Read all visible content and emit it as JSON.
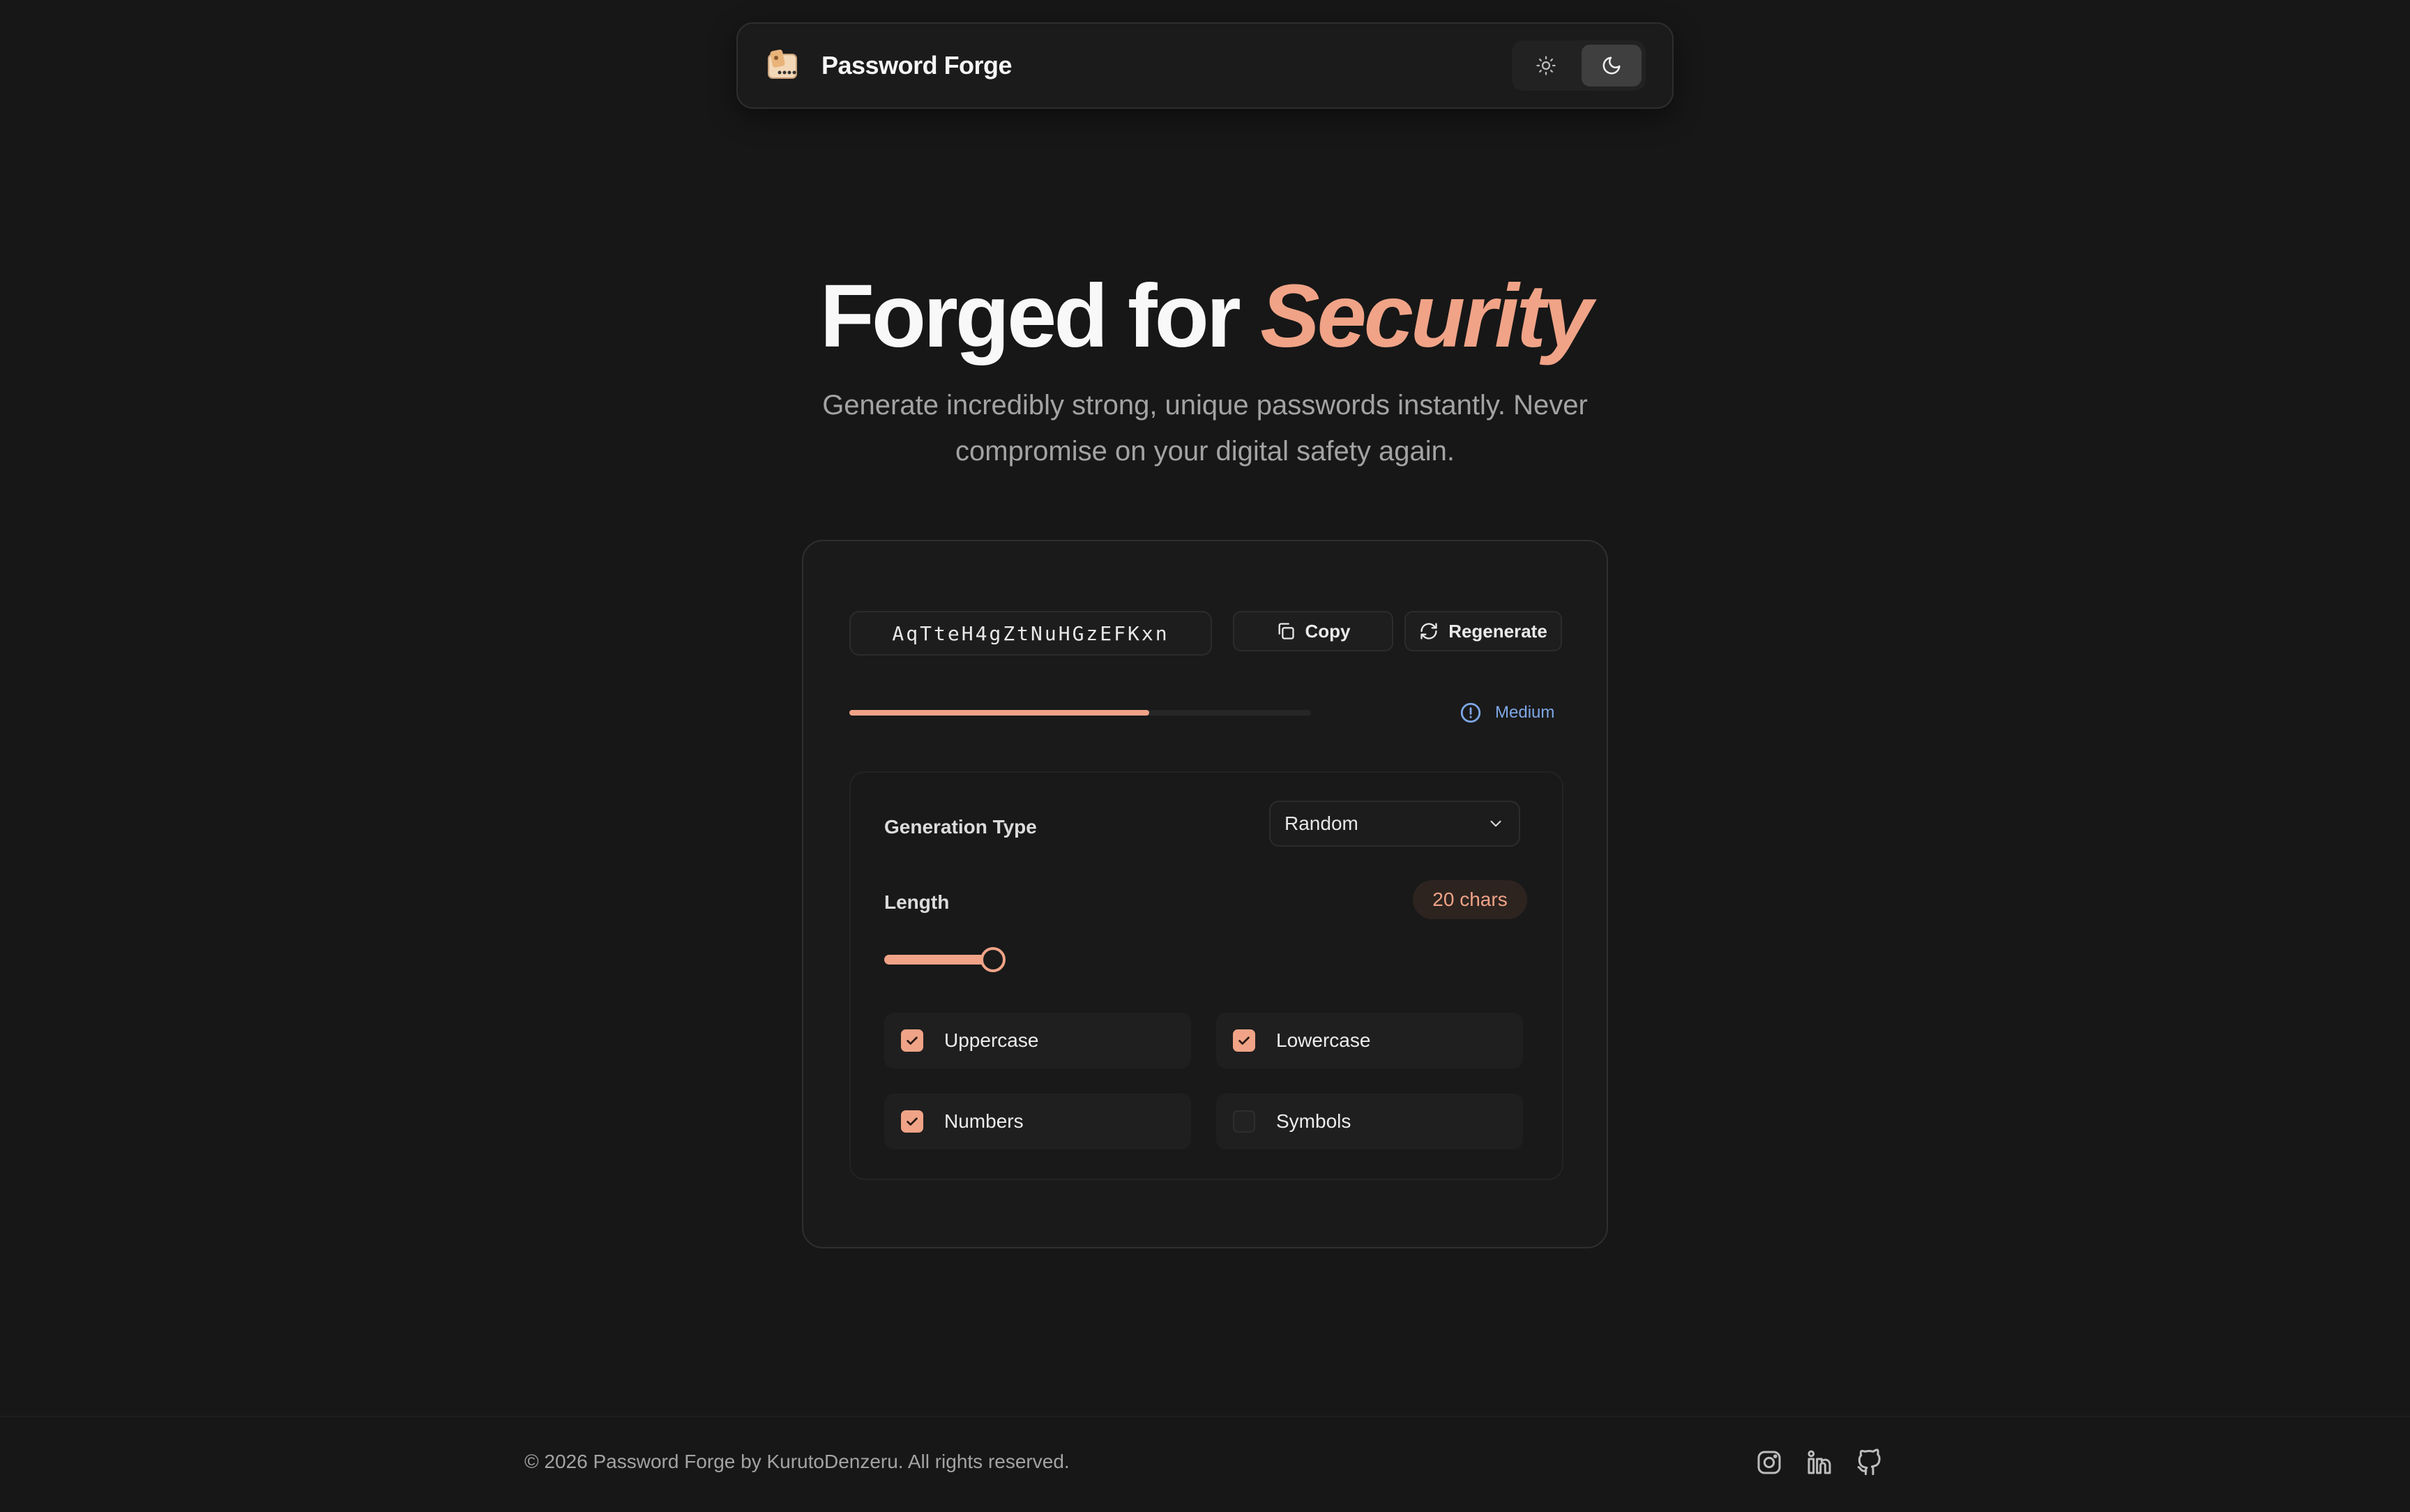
{
  "header": {
    "brand": "Password Forge",
    "logo_icon": "password-card-icon",
    "theme": {
      "light_icon": "sun-icon",
      "dark_icon": "moon-icon",
      "selected": "dark"
    }
  },
  "hero": {
    "title_main": "Forged for",
    "title_accent": "Security",
    "subtitle": "Generate incredibly strong, unique passwords instantly. Never compromise on your digital safety again."
  },
  "generator": {
    "password": "AqTteH4gZtNuHGzEFKxn",
    "copy_label": "Copy",
    "regenerate_label": "Regenerate",
    "strength": {
      "label": "Medium",
      "level": 0.65,
      "color": "#f0a387",
      "label_color": "#7ea7e6"
    },
    "settings": {
      "generation_type_label": "Generation Type",
      "generation_type_value": "Random",
      "length_label": "Length",
      "length_badge": "20 chars",
      "length_value": 20,
      "options": {
        "uppercase": {
          "label": "Uppercase",
          "checked": true
        },
        "lowercase": {
          "label": "Lowercase",
          "checked": true
        },
        "numbers": {
          "label": "Numbers",
          "checked": true
        },
        "symbols": {
          "label": "Symbols",
          "checked": false
        }
      }
    }
  },
  "footer": {
    "copyright": "© 2026 Password Forge by KurutoDenzeru. All rights reserved.",
    "socials": [
      "instagram-icon",
      "linkedin-icon",
      "github-icon"
    ]
  },
  "colors": {
    "accent": "#f0a387",
    "background": "#171717",
    "info": "#7ea7e6"
  }
}
